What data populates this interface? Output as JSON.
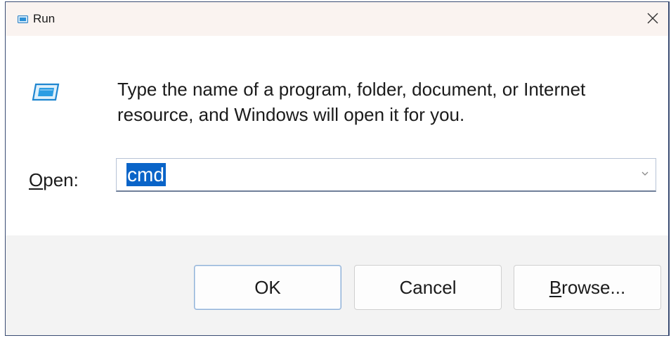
{
  "window": {
    "title": "Run",
    "title_icon": "run-icon",
    "close_icon": "close-icon"
  },
  "content": {
    "icon": "run-app-icon",
    "description": "Type the name of a program, folder, document, or Internet resource, and Windows will open it for you.",
    "open_label_mnemonic": "O",
    "open_label_rest": "pen:",
    "open_value": "cmd",
    "dropdown_icon": "chevron-down-icon"
  },
  "buttons": {
    "ok": "OK",
    "cancel": "Cancel",
    "browse_mnemonic": "B",
    "browse_rest": "rowse..."
  },
  "colors": {
    "accent": "#0a64c8",
    "titlebar": "#faf3f0",
    "footer": "#f3f3f3",
    "icon_blue": "#2b8fd6"
  }
}
